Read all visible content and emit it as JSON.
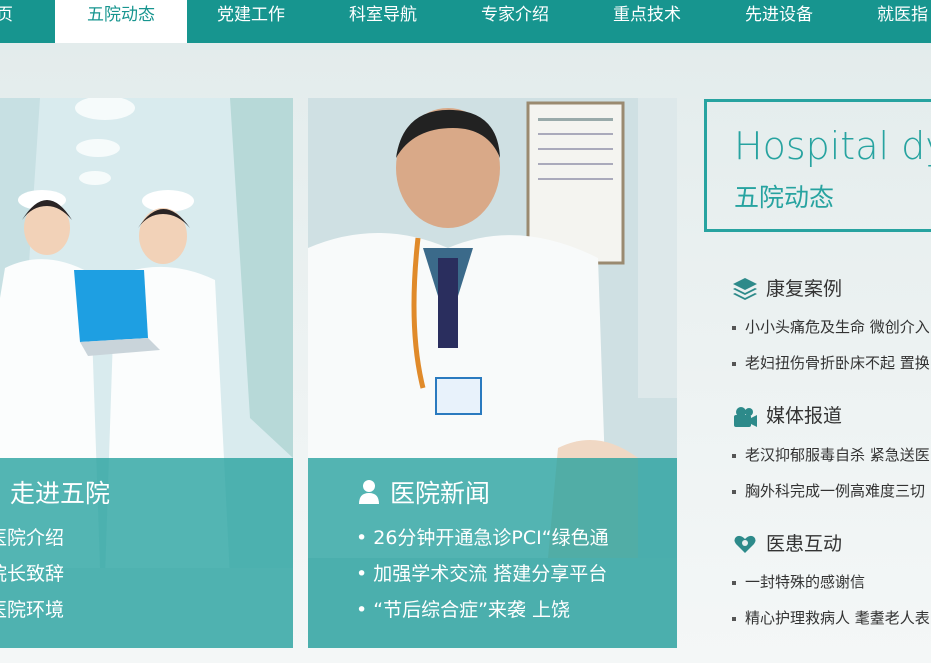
{
  "nav": {
    "items": [
      "页",
      "五院动态",
      "党建工作",
      "科室导航",
      "专家介绍",
      "重点技术",
      "先进设备",
      "就医指"
    ]
  },
  "panels": {
    "about": {
      "title": "走进五院",
      "links": [
        "医院介绍",
        "院长致辞",
        "医院环境"
      ]
    },
    "news": {
      "title": "医院新闻",
      "links": [
        "• 26分钟开通急诊PCI“绿色通",
        "• 加强学术交流 搭建分享平台",
        "•  “节后综合症”来袭 上饶"
      ]
    }
  },
  "dynamics": {
    "title_en": "Hospital dy",
    "title_cn": "五院动态"
  },
  "sections": [
    {
      "title": "康复案例",
      "icon": "layers-icon",
      "items": [
        "小小头痛危及生命 微创介入",
        "老妇扭伤骨折卧床不起 置换"
      ]
    },
    {
      "title": "媒体报道",
      "icon": "camera-icon",
      "items": [
        "老汉抑郁服毒自杀 紧急送医",
        "胸外科完成一例高难度三切"
      ]
    },
    {
      "title": "医患互动",
      "icon": "heart-hands-icon",
      "items": [
        "一封特殊的感谢信",
        "精心护理救病人 耄耋老人表"
      ]
    }
  ],
  "colors": {
    "brand": "#17958f",
    "accent": "#27a3a0"
  }
}
